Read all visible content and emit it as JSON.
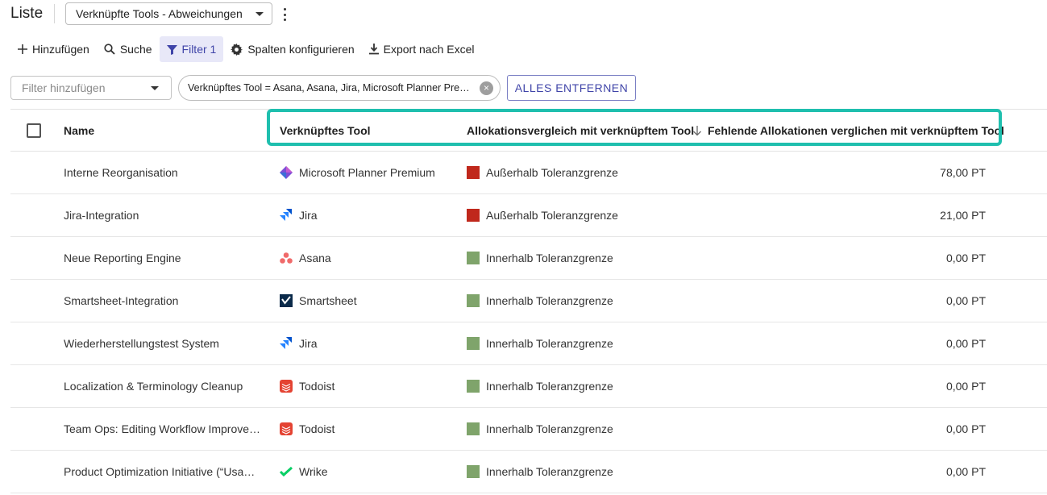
{
  "header": {
    "title": "Liste",
    "view_select": "Verknüpfte Tools - Abweichungen"
  },
  "toolbar": {
    "add": "Hinzufügen",
    "search": "Suche",
    "filter": "Filter 1",
    "columns": "Spalten konfigurieren",
    "export": "Export nach Excel"
  },
  "filters": {
    "placeholder": "Filter hinzufügen",
    "chip": "Verknüpftes Tool = Asana, Asana, Jira, Microsoft Planner Premium, Smartsheet, Todoist, Wrike",
    "clear_all": "ALLES ENTFERNEN"
  },
  "colors": {
    "accent": "#3f44a8",
    "highlight": "#1fbfae",
    "out_of_tolerance": "#c0281c",
    "within_tolerance": "#7fa46b"
  },
  "table": {
    "columns": {
      "name": "Name",
      "tool": "Verknüpftes Tool",
      "comparison": "Allokationsvergleich mit verknüpftem Tool",
      "missing": "Fehlende Allokationen verglichen mit verknüpftem Tool"
    },
    "rows": [
      {
        "name": "Interne Reorganisation",
        "tool": "Microsoft Planner Premium",
        "tool_icon": "planner-icon",
        "status": "Außerhalb Toleranzgrenze",
        "status_color": "#c0281c",
        "missing": "78,00 PT"
      },
      {
        "name": "Jira-Integration",
        "tool": "Jira",
        "tool_icon": "jira-icon",
        "status": "Außerhalb Toleranzgrenze",
        "status_color": "#c0281c",
        "missing": "21,00 PT"
      },
      {
        "name": "Neue Reporting Engine",
        "tool": "Asana",
        "tool_icon": "asana-icon",
        "status": "Innerhalb Toleranzgrenze",
        "status_color": "#7fa46b",
        "missing": "0,00 PT"
      },
      {
        "name": "Smartsheet-Integration",
        "tool": "Smartsheet",
        "tool_icon": "smartsheet-icon",
        "status": "Innerhalb Toleranzgrenze",
        "status_color": "#7fa46b",
        "missing": "0,00 PT"
      },
      {
        "name": "Wiederherstellungstest System",
        "tool": "Jira",
        "tool_icon": "jira-icon",
        "status": "Innerhalb Toleranzgrenze",
        "status_color": "#7fa46b",
        "missing": "0,00 PT"
      },
      {
        "name": "Localization & Terminology Cleanup",
        "tool": "Todoist",
        "tool_icon": "todoist-icon",
        "status": "Innerhalb Toleranzgrenze",
        "status_color": "#7fa46b",
        "missing": "0,00 PT"
      },
      {
        "name": "Team Ops: Editing Workflow Improve…",
        "tool": "Todoist",
        "tool_icon": "todoist-icon",
        "status": "Innerhalb Toleranzgrenze",
        "status_color": "#7fa46b",
        "missing": "0,00 PT"
      },
      {
        "name": "Product Optimization Initiative (“Usa…",
        "tool": "Wrike",
        "tool_icon": "wrike-icon",
        "status": "Innerhalb Toleranzgrenze",
        "status_color": "#7fa46b",
        "missing": "0,00 PT"
      }
    ]
  }
}
